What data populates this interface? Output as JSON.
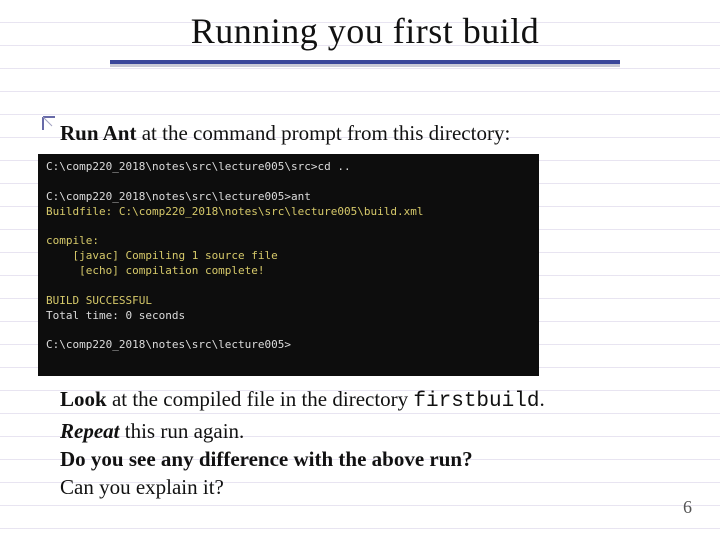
{
  "slide": {
    "title": "Running you first build",
    "page_number": "6"
  },
  "body": {
    "line1_bold": "Run Ant",
    "line1_rest": " at the command prompt from this directory:",
    "look_bold": "Look",
    "look_rest": " at the compiled file in the directory ",
    "look_mono": "firstbuild",
    "look_period": ".",
    "repeat_label": "Repeat",
    "repeat_rest": "  this run again.",
    "question1": "Do you see any difference with the above run?",
    "question2": "Can you explain it?"
  },
  "terminal": {
    "l1": "C:\\comp220_2018\\notes\\src\\lecture005\\src>cd ..",
    "l2": "",
    "l3": "C:\\comp220_2018\\notes\\src\\lecture005>ant",
    "l4": "Buildfile: C:\\comp220_2018\\notes\\src\\lecture005\\build.xml",
    "l5": "",
    "l6": "compile:",
    "l7": "    [javac] Compiling 1 source file",
    "l8": "     [echo] compilation complete!",
    "l9": "",
    "l10": "BUILD SUCCESSFUL",
    "l11": "Total time: 0 seconds",
    "l12": "",
    "l13": "C:\\comp220_2018\\notes\\src\\lecture005>"
  }
}
